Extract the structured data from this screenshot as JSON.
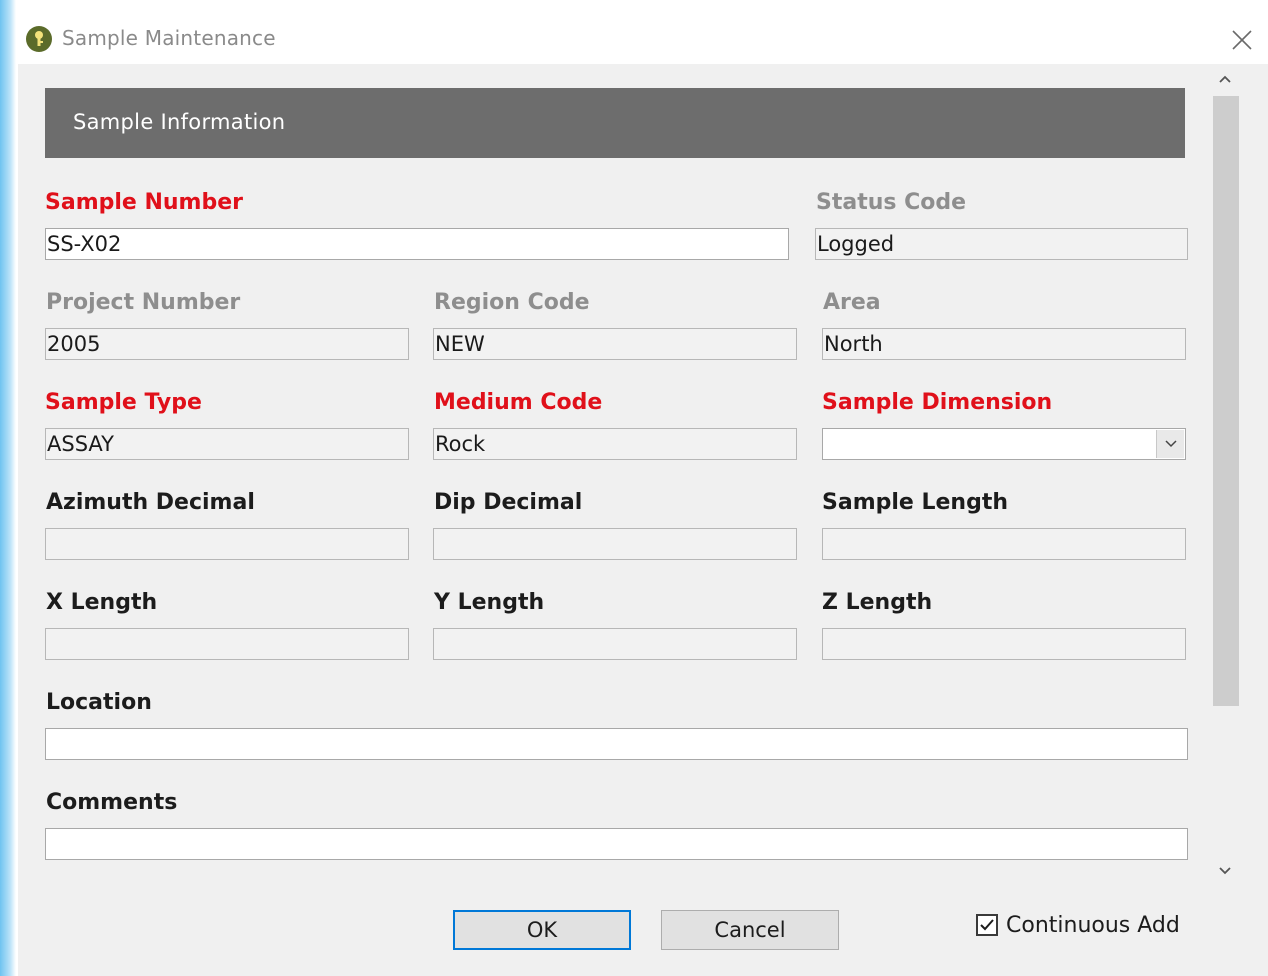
{
  "window": {
    "title": "Sample Maintenance",
    "icon": "key-icon",
    "accent_color": "#0078d7"
  },
  "section": {
    "title": "Sample Information"
  },
  "fields": {
    "sample_number": {
      "label": "Sample Number",
      "value": "SS-X02"
    },
    "status_code": {
      "label": "Status Code",
      "value": "Logged"
    },
    "project_number": {
      "label": "Project Number",
      "value": "2005"
    },
    "region_code": {
      "label": "Region Code",
      "value": "NEW"
    },
    "area": {
      "label": "Area",
      "value": "North"
    },
    "sample_type": {
      "label": "Sample Type",
      "value": "ASSAY"
    },
    "medium_code": {
      "label": "Medium Code",
      "value": "Rock"
    },
    "sample_dimension": {
      "label": "Sample Dimension",
      "value": ""
    },
    "azimuth_decimal": {
      "label": "Azimuth Decimal",
      "value": ""
    },
    "dip_decimal": {
      "label": "Dip Decimal",
      "value": ""
    },
    "sample_length": {
      "label": "Sample Length",
      "value": ""
    },
    "x_length": {
      "label": "X Length",
      "value": ""
    },
    "y_length": {
      "label": "Y Length",
      "value": ""
    },
    "z_length": {
      "label": "Z Length",
      "value": ""
    },
    "location": {
      "label": "Location",
      "value": ""
    },
    "comments": {
      "label": "Comments",
      "value": ""
    }
  },
  "colors": {
    "required_label": "#e0101a",
    "disabled_label": "#8e8e8e",
    "header_bg": "#6d6d6d"
  },
  "buttons": {
    "ok": "OK",
    "cancel": "Cancel"
  },
  "continuous_add": {
    "label": "Continuous Add",
    "checked": true
  }
}
